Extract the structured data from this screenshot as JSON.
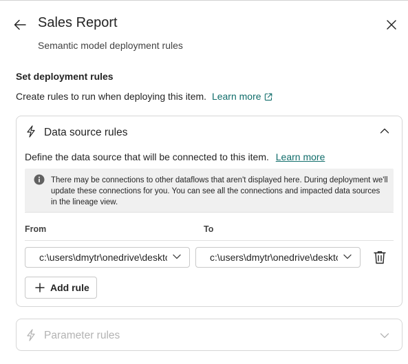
{
  "header": {
    "title": "Sales Report",
    "subtitle": "Semantic model deployment rules"
  },
  "section": {
    "title": "Set deployment rules",
    "description": "Create rules to run when deploying this item.",
    "learn_more": "Learn more"
  },
  "data_source_rules": {
    "title": "Data source rules",
    "expanded": true,
    "description": "Define the data source that will be connected to this item.",
    "learn_more": "Learn more",
    "info_text": "There may be connections to other dataflows that aren't displayed here. During deployment we'll update these connections for you. You can see all the connections and impacted data sources in the lineage view.",
    "from_label": "From",
    "to_label": "To",
    "rules": [
      {
        "from": "c:\\users\\dmytr\\onedrive\\desktop",
        "to": "c:\\users\\dmytr\\onedrive\\desktop"
      }
    ],
    "add_rule": "Add rule"
  },
  "parameter_rules": {
    "title": "Parameter rules",
    "disabled": true
  },
  "icons": {
    "back": "arrow-left-icon",
    "close": "close-icon",
    "external": "open-in-new-icon",
    "rule": "lightning-bolt-icon",
    "info": "info-icon",
    "delete": "trash-icon",
    "add": "plus-icon"
  },
  "colors": {
    "link": "#0f6c6a",
    "border": "#d6d6d6",
    "info_bg": "#f0f0f0",
    "disabled_text": "#b3b3b3"
  }
}
